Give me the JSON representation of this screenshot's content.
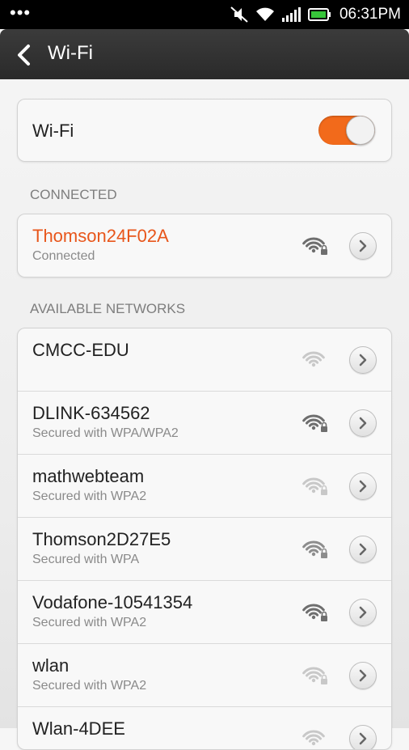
{
  "status_bar": {
    "time": "06:31PM",
    "overflow_icon": "dots-icon",
    "icons": [
      "mute-icon",
      "wifi-icon",
      "cell-signal-icon",
      "battery-charging-icon"
    ]
  },
  "header": {
    "title": "Wi-Fi",
    "back_icon": "back-arrow-icon"
  },
  "wifi_toggle": {
    "label": "Wi-Fi",
    "on": true,
    "accent": "#f26a1b"
  },
  "sections": {
    "connected": "CONNECTED",
    "available": "AVAILABLE NETWORKS"
  },
  "connected_network": {
    "name": "Thomson24F02A",
    "status": "Connected",
    "color": "#e8561b",
    "locked": true,
    "strength": "strong"
  },
  "networks": [
    {
      "name": "CMCC-EDU",
      "security": "",
      "locked": false,
      "strength": "faint"
    },
    {
      "name": "DLINK-634562",
      "security": "Secured with WPA/WPA2",
      "locked": true,
      "strength": "strong"
    },
    {
      "name": "mathwebteam",
      "security": "Secured with WPA2",
      "locked": true,
      "strength": "faint"
    },
    {
      "name": "Thomson2D27E5",
      "security": "Secured with WPA",
      "locked": true,
      "strength": "medium"
    },
    {
      "name": "Vodafone-10541354",
      "security": "Secured with WPA2",
      "locked": true,
      "strength": "strong"
    },
    {
      "name": "wlan",
      "security": "Secured with WPA2",
      "locked": true,
      "strength": "faint"
    },
    {
      "name": "Wlan-4DEE",
      "security": "",
      "locked": false,
      "strength": "faint"
    }
  ]
}
